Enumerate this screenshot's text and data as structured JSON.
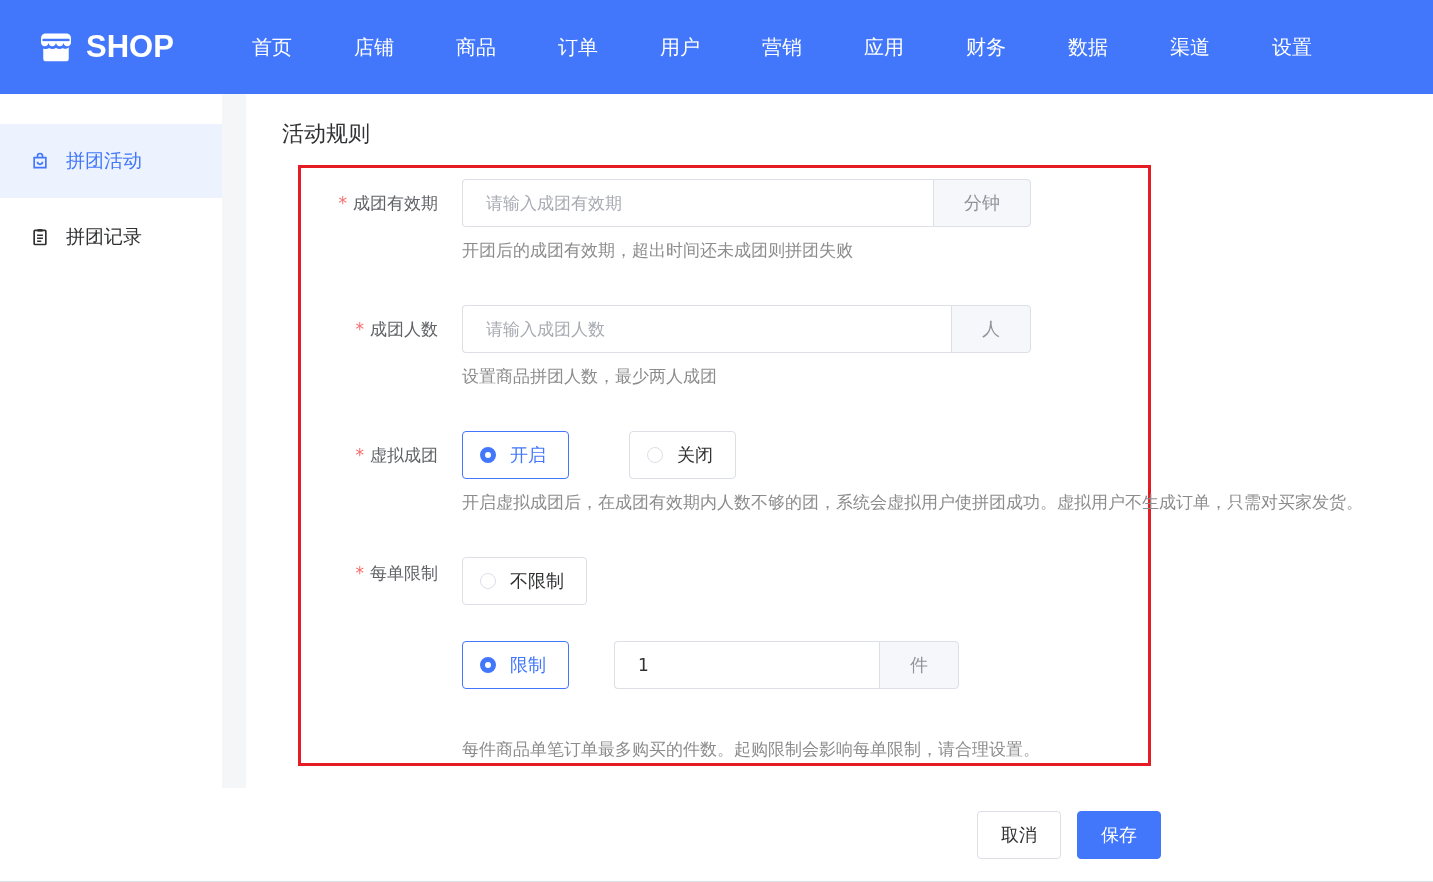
{
  "nav": {
    "logo": "SHOP",
    "items": [
      {
        "label": "首页",
        "selected": false
      },
      {
        "label": "店铺",
        "selected": false
      },
      {
        "label": "商品",
        "selected": false
      },
      {
        "label": "订单",
        "selected": false
      },
      {
        "label": "用户",
        "selected": false
      },
      {
        "label": "营销",
        "selected": false
      },
      {
        "label": "应用",
        "selected": false
      },
      {
        "label": "财务",
        "selected": false
      },
      {
        "label": "数据",
        "selected": false
      },
      {
        "label": "渠道",
        "selected": false
      },
      {
        "label": "设置",
        "selected": false
      }
    ]
  },
  "sidebar": {
    "items": [
      {
        "label": "拼团活动",
        "selected": true
      },
      {
        "label": "拼团记录",
        "selected": false
      }
    ]
  },
  "section_title": "活动规则",
  "form": {
    "fields": [
      {
        "kind": "input",
        "label": "成团有效期",
        "required_mark": "*",
        "placeholder": "请输入成团有效期",
        "unit": "分钟",
        "help": "开团后的成团有效期，超出时间还未成团则拼团失败"
      },
      {
        "kind": "input",
        "label": "成团人数",
        "required_mark": "*",
        "placeholder": "请输入成团人数",
        "unit": "人",
        "help": "设置商品拼团人数，最少两人成团"
      },
      {
        "kind": "radio",
        "label": "虚拟成团",
        "required_mark": "*",
        "options": [
          {
            "label": "开启",
            "selected": true
          },
          {
            "label": "关闭",
            "selected": false
          }
        ],
        "help": "开启虚拟成团后，在成团有效期内人数不够的团，系统会虚拟用户使拼团成功。虚拟用户不生成订单，只需对买家发货。"
      },
      {
        "kind": "limit",
        "label": "每单限制",
        "required_mark": "*",
        "options": [
          {
            "label": "不限制",
            "selected": false
          },
          {
            "label": "限制",
            "selected": true,
            "value": "1",
            "unit": "件"
          }
        ],
        "help": "每件商品单笔订单最多购买的件数。起购限制会影响每单限制，请合理设置。"
      }
    ]
  },
  "buttons": [
    {
      "label": "取消",
      "kind": "secondary"
    },
    {
      "label": "保存",
      "kind": "primary"
    }
  ]
}
